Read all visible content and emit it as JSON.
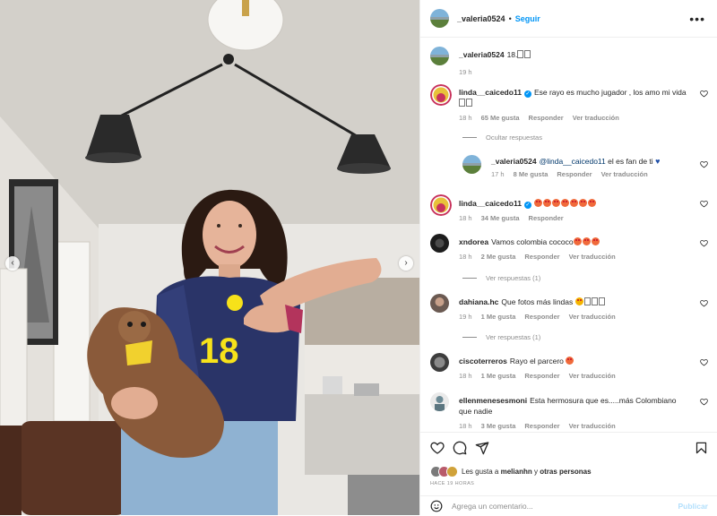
{
  "post": {
    "author": "_valeria0524",
    "follow_label": "Seguir",
    "more_icon": "more-options-icon",
    "separator": "•"
  },
  "photo": {
    "jersey_number": "18",
    "prev_icon": "chevron-left-icon",
    "next_icon": "chevron-right-icon",
    "prev_glyph": "‹",
    "next_glyph": "›"
  },
  "caption": {
    "user": "_valeria0524",
    "text": "18.",
    "time": "19 h"
  },
  "comments": [
    {
      "user": "linda__caicedo11",
      "verified": true,
      "text": "Ese rayo es mucho jugador , los amo mi vida",
      "time": "18 h",
      "likes": "65 Me gusta",
      "reply": "Responder",
      "translate": "Ver traducción"
    },
    {
      "user": "_valeria0524",
      "mention": "@linda__caicedo11",
      "text": "el es fan de ti",
      "time": "17 h",
      "likes": "8 Me gusta",
      "reply": "Responder",
      "translate": "Ver traducción"
    },
    {
      "user": "linda__caicedo11",
      "verified": true,
      "text": "",
      "time": "18 h",
      "likes": "34 Me gusta",
      "reply": "Responder"
    },
    {
      "user": "xndorea",
      "text": "Vamos colombia cococo",
      "time": "18 h",
      "likes": "2 Me gusta",
      "reply": "Responder",
      "translate": "Ver traducción"
    },
    {
      "user": "dahiana.hc",
      "text": "Que fotos más lindas",
      "time": "19 h",
      "likes": "1 Me gusta",
      "reply": "Responder",
      "translate": "Ver traducción"
    },
    {
      "user": "ciscoterreros",
      "text": "Rayo el parcero",
      "time": "18 h",
      "likes": "1 Me gusta",
      "reply": "Responder",
      "translate": "Ver traducción"
    },
    {
      "user": "ellenmenesesmoni",
      "text": "Esta hermosura que es.....más Colombiano que nadie",
      "time": "18 h",
      "likes": "3 Me gusta",
      "reply": "Responder",
      "translate": "Ver traducción"
    }
  ],
  "hide_replies": "Ocultar respuestas",
  "view_replies": [
    "Ver respuestas (1)",
    "Ver respuestas (1)"
  ],
  "footer": {
    "liked_by_prefix": "Les gusta a",
    "liked_by_user": "melianhn",
    "liked_by_conj": "y",
    "liked_by_rest": "otras personas",
    "time_ago": "HACE 19 HORAS",
    "comment_placeholder": "Agrega un comentario...",
    "publish_label": "Publicar",
    "icons": [
      "like-icon",
      "comment-icon",
      "share-icon",
      "save-icon",
      "emoji-icon"
    ]
  },
  "colors": {
    "accent": "#0095f6",
    "text": "#262626",
    "muted": "#8e8e8e",
    "jersey": "#2a3468",
    "jersey_number": "#f7e21a"
  }
}
